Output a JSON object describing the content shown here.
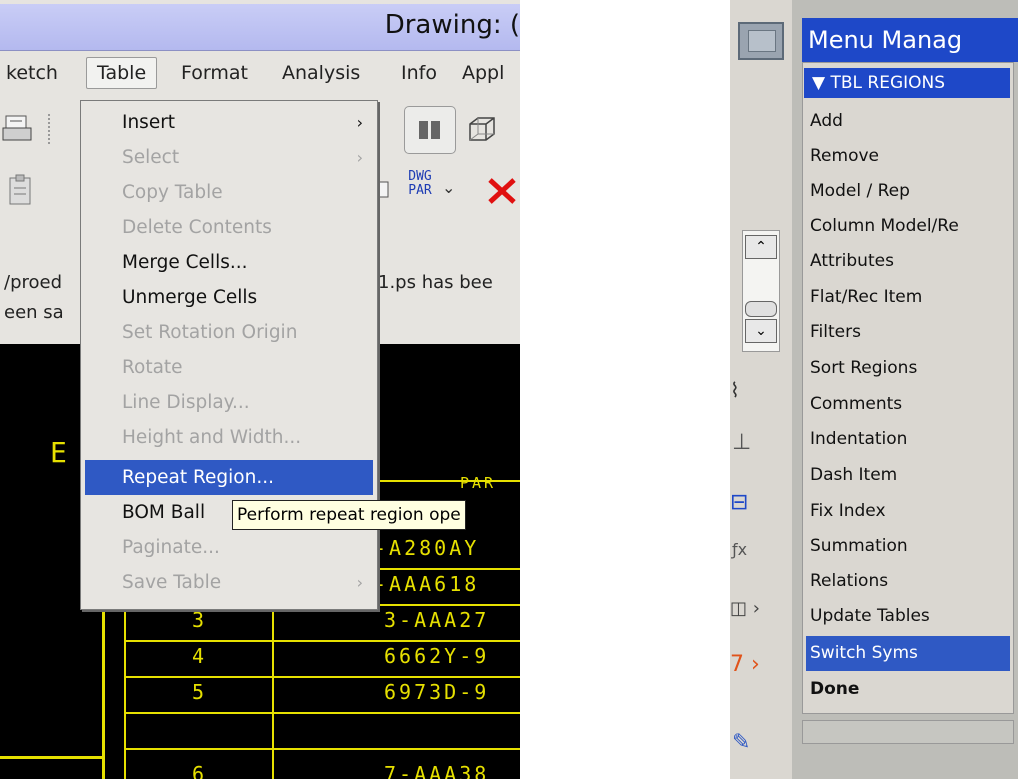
{
  "window": {
    "title": "Drawing: ("
  },
  "menubar": {
    "items": [
      {
        "label": "ketch"
      },
      {
        "label": "Table"
      },
      {
        "label": "Format"
      },
      {
        "label": "Analysis"
      },
      {
        "label": "Info"
      },
      {
        "label": "Appl"
      }
    ]
  },
  "toolbar": {
    "dwg_par": "DWG PAR",
    "dropdown_arrow": "⌄"
  },
  "messages": {
    "line1_left": "/proed",
    "line1_right": "1.ps has bee",
    "line2_left": "een sa"
  },
  "table_menu": {
    "items": [
      {
        "label": "Insert",
        "enabled": true,
        "submenu": true
      },
      {
        "label": "Select",
        "enabled": false,
        "submenu": true
      },
      {
        "label": "Copy Table",
        "enabled": false
      },
      {
        "label": "Delete Contents",
        "enabled": false
      },
      {
        "label": "Merge Cells...",
        "enabled": true
      },
      {
        "label": "Unmerge Cells",
        "enabled": true
      },
      {
        "label": "Set Rotation Origin",
        "enabled": false
      },
      {
        "label": "Rotate",
        "enabled": false
      },
      {
        "label": "Line Display...",
        "enabled": false
      },
      {
        "label": "Height and Width...",
        "enabled": false
      },
      {
        "label": "Repeat Region...",
        "enabled": true,
        "selected": true
      },
      {
        "label": "BOM Ball",
        "enabled": true
      },
      {
        "label": "Paginate...",
        "enabled": false
      },
      {
        "label": "Save Table",
        "enabled": false,
        "submenu": true
      }
    ]
  },
  "tooltip": {
    "text": "Perform repeat region ope"
  },
  "drawing": {
    "letter": "E",
    "header_partial": "PAR",
    "rows": [
      {
        "index": "",
        "part": "-A280AY"
      },
      {
        "index": "",
        "part": "-AAA618"
      },
      {
        "index": "3",
        "part": "3-AAA27"
      },
      {
        "index": "4",
        "part": "6662Y-9"
      },
      {
        "index": "5",
        "part": "6973D-9"
      },
      {
        "index": "6",
        "part": "7-AAA38"
      }
    ]
  },
  "menu_manager": {
    "title": "Menu Manag",
    "section": "TBL REGIONS",
    "items": [
      {
        "label": "Add"
      },
      {
        "label": "Remove"
      },
      {
        "label": "Model / Rep"
      },
      {
        "label": "Column Model/Re"
      },
      {
        "label": "Attributes"
      },
      {
        "label": "Flat/Rec Item"
      },
      {
        "label": "Filters"
      },
      {
        "label": "Sort Regions"
      },
      {
        "label": "Comments"
      },
      {
        "label": "Indentation"
      },
      {
        "label": "Dash Item"
      },
      {
        "label": "Fix Index"
      },
      {
        "label": "Summation"
      },
      {
        "label": "Relations"
      },
      {
        "label": "Update Tables"
      },
      {
        "label": "Switch Syms",
        "selected": true
      },
      {
        "label": "Done",
        "bold": true
      }
    ]
  },
  "colors": {
    "selection": "#2f59c4",
    "cad_yellow": "#e6e000",
    "cad_background": "#000000",
    "tooltip_bg": "#ffffe1",
    "title_bar": "#c9cdf6"
  }
}
